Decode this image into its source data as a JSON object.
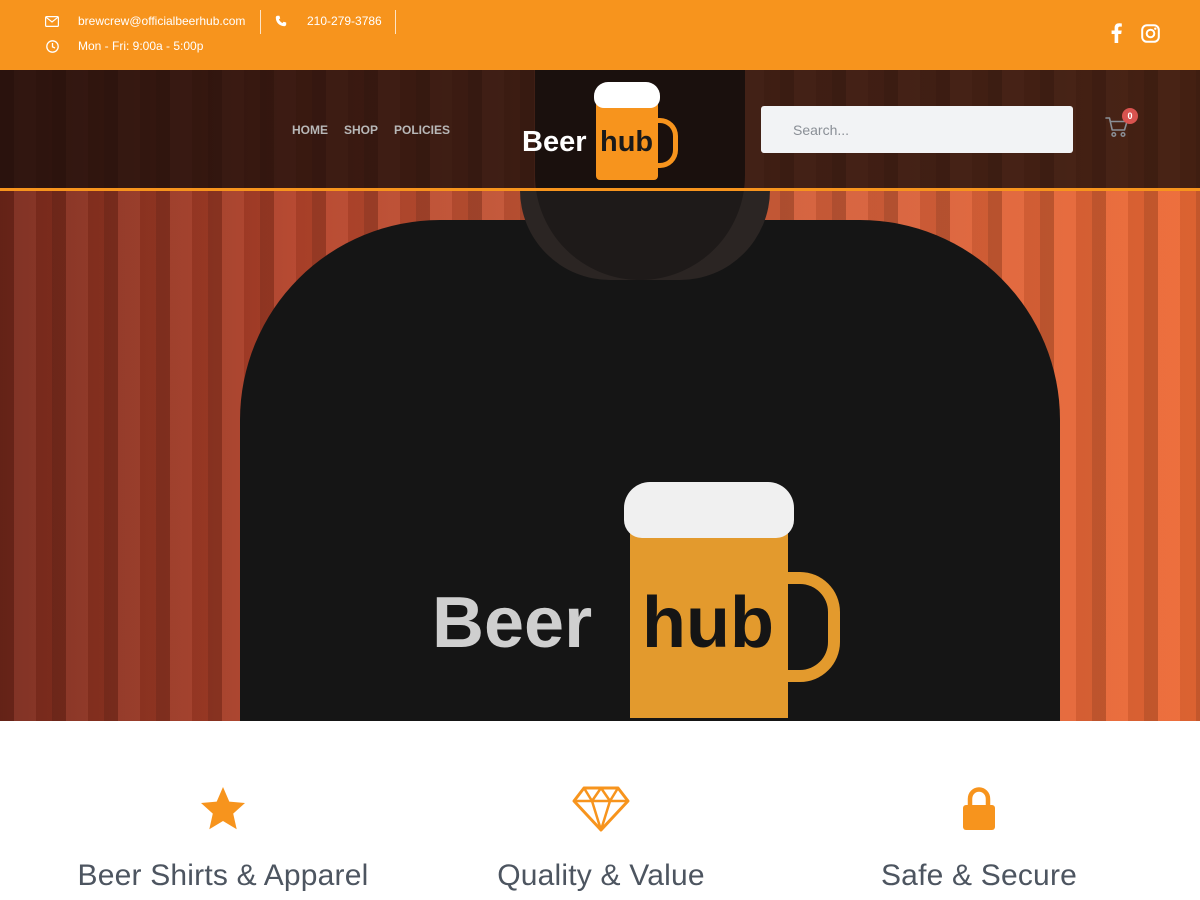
{
  "topbar": {
    "email": "brewcrew@officialbeerhub.com",
    "phone": "210-279-3786",
    "hours": "Mon - Fri: 9:00a - 5:00p",
    "social": [
      "facebook-icon",
      "instagram-icon"
    ]
  },
  "header": {
    "nav": [
      {
        "label": "HOME"
      },
      {
        "label": "SHOP"
      },
      {
        "label": "POLICIES"
      }
    ],
    "logo": {
      "word1": "Beer",
      "word2": "hub"
    },
    "search": {
      "placeholder": "Search..."
    },
    "cart": {
      "count": "0"
    }
  },
  "hero": {
    "shirt_logo": {
      "word1": "Beer",
      "word2": "hub"
    }
  },
  "features": [
    {
      "icon": "star-icon",
      "title": "Beer Shirts & Apparel"
    },
    {
      "icon": "diamond-icon",
      "title": "Quality & Value"
    },
    {
      "icon": "lock-icon",
      "title": "Safe & Secure"
    }
  ],
  "colors": {
    "accent": "#f7941d",
    "heading": "#4d5560",
    "badge": "#d9534f"
  }
}
